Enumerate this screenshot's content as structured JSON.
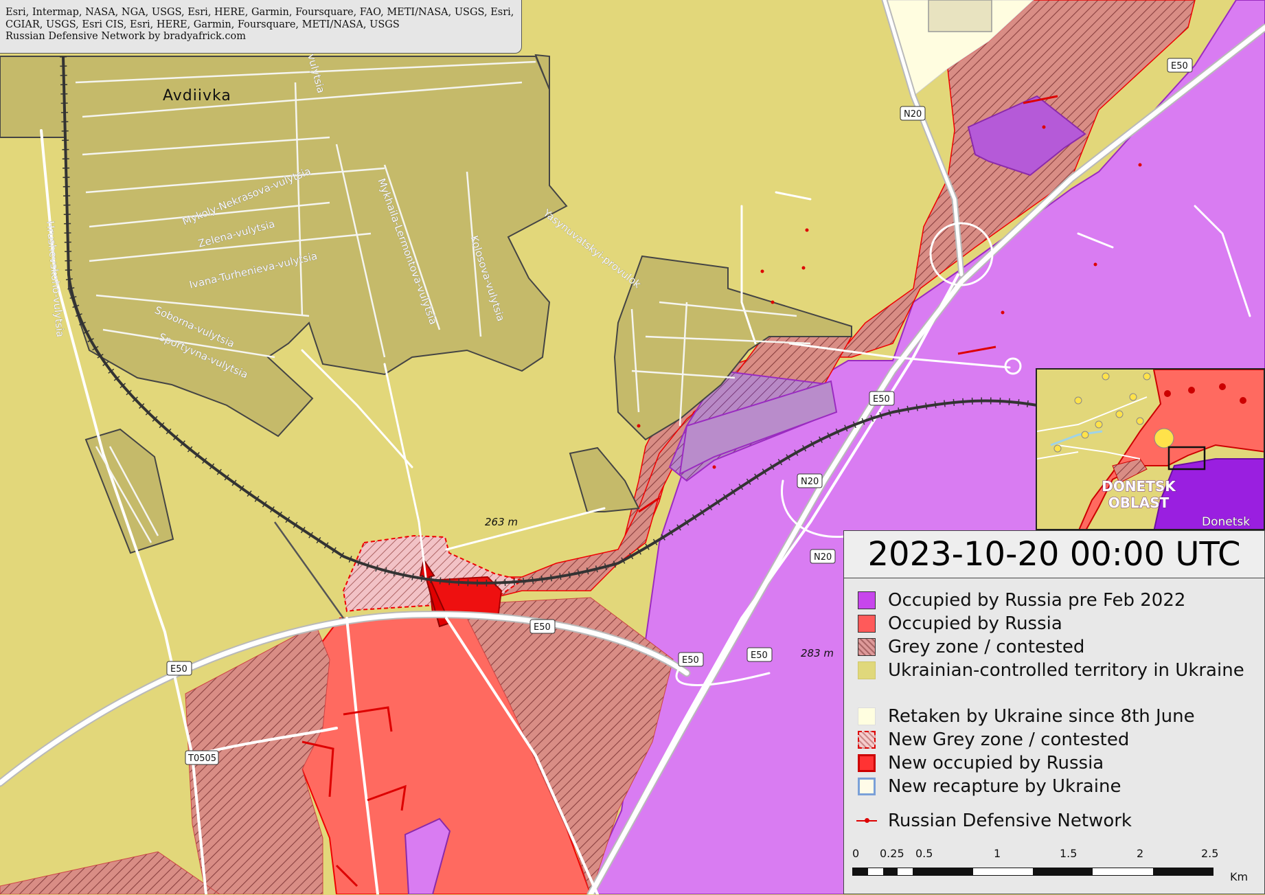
{
  "attribution": {
    "lines": [
      "Esri, Intermap, NASA, NGA, USGS, Esri, HERE, Garmin, Foursquare, FAO, METI/NASA, USGS, Esri,",
      "CGIAR, USGS, Esri CIS, Esri, HERE, Garmin, Foursquare, METI/NASA, USGS",
      "Russian Defensive Network by bradyafrick.com"
    ]
  },
  "map": {
    "town": "Avdiivka",
    "streets": {
      "vulytsia_top": "vulytsia",
      "mykoly": "Mykoly-Nekrasova-vulytsia",
      "zelena": "Zelena-vulytsia",
      "ivana": "Ivana-Turhenieva-vulytsia",
      "soborna": "Soborna-vulytsia",
      "sportyvna": "Sportyvna-vulytsia",
      "hrushevskoho": "Hrushevskoho-vulytsia",
      "lermontova": "Mykhaila-Lermontova-vulytsia",
      "kolosova": "Kolosova-vulytsia",
      "yasynuvatskyi": "Yasynuvatskyi-provulok"
    },
    "road_shields": {
      "e50_a": "E50",
      "e50_b": "E50",
      "e50_c": "E50",
      "e50_d": "E50",
      "e50_e": "E50",
      "e50_f": "E50",
      "n20_a": "N20",
      "n20_b": "N20",
      "n20_c": "N20",
      "t0505": "T0505"
    },
    "elevations": {
      "a": "263 m",
      "b": "283 m"
    },
    "colors": {
      "ukraine": "#e2d77a",
      "urban": "#c5ba6a",
      "occupied": "#ff6a60",
      "pre2022": "#d97cf2",
      "grey_zone_hatch": "#b35a5a",
      "new_occupied": "#ee1010",
      "retaken": "#fffde0",
      "road": "#ffffff",
      "rail": "#333333",
      "defense": "#dd0000"
    }
  },
  "inset": {
    "oblast_line1": "DONETSK",
    "oblast_line2": "OBLAST",
    "city": "Donetsk"
  },
  "legend": {
    "datetime": "2023-10-20  00:00 UTC",
    "items": [
      "Occupied by Russia pre Feb 2022",
      "Occupied by Russia",
      "Grey zone / contested",
      "Ukrainian-controlled territory in Ukraine",
      "Retaken by Ukraine since 8th June",
      "New Grey zone / contested",
      "New occupied by Russia",
      "New recapture by Ukraine",
      "Russian Defensive Network"
    ],
    "scale": {
      "ticks": [
        "0",
        "0.25",
        "0.5",
        "1",
        "1.5",
        "2",
        "2.5"
      ],
      "unit": "Km"
    }
  }
}
